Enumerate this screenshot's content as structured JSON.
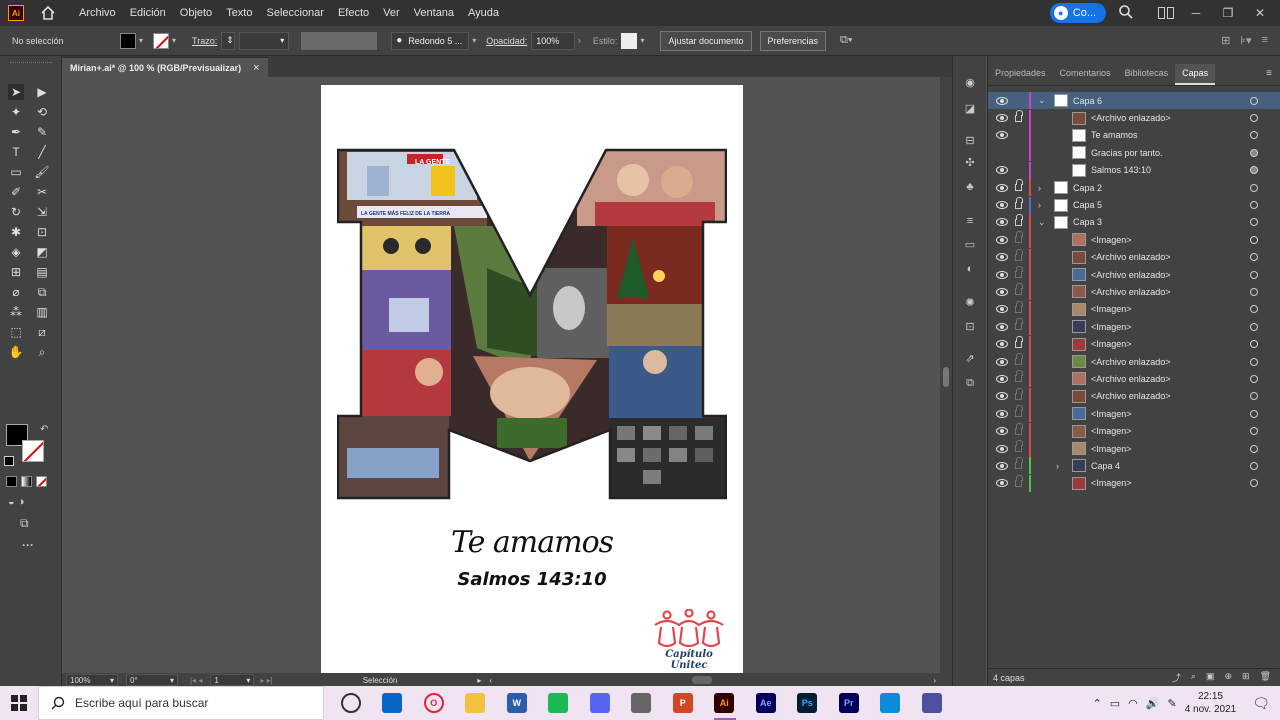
{
  "menubar": {
    "app_logo": "Ai",
    "items": [
      "Archivo",
      "Edición",
      "Objeto",
      "Texto",
      "Seleccionar",
      "Efecto",
      "Ver",
      "Ventana",
      "Ayuda"
    ],
    "cloud_label": "Co...",
    "icons": [
      "home-icon",
      "search-icon",
      "arrange-icon",
      "window-icon"
    ]
  },
  "controlbar": {
    "selection": "No selección",
    "stroke_label": "Trazo:",
    "brush": "Redondo 5 ...",
    "opacity_label": "Opacidad:",
    "opacity_value": "100%",
    "style_label": "Estilo:",
    "adjust_doc": "Ajustar documento",
    "preferences": "Preferencias"
  },
  "document": {
    "tab_title": "Mirian+.ai* @ 100 % (RGB/Previsualizar)",
    "close": "×"
  },
  "artboard": {
    "headline": "Te amamos",
    "verse": "Salmos 143:10",
    "logo_text": "Capítulo Unitec",
    "tv_caption": "LA GENTE MÁS FELIZ DE LA TIERRA",
    "tv_banner": "LA GENTE"
  },
  "statusbar": {
    "zoom": "100%",
    "rotation": "0°",
    "artboard_num": "1",
    "tool": "Selección"
  },
  "layers_panel": {
    "tabs": [
      "Propiedades",
      "Comentarios",
      "Bibliotecas",
      "Capas"
    ],
    "active_tab": "Capas",
    "rows": [
      {
        "name": "Capa 6",
        "color": "#cc44cc",
        "expanded": true,
        "indent": 0,
        "lock": false,
        "selected": true,
        "target_filled": false
      },
      {
        "name": "<Archivo enlazado>",
        "color": "#cc44cc",
        "indent": 1,
        "lock": true,
        "lock_faint": false,
        "target_filled": false
      },
      {
        "name": "Te amamos",
        "color": "#cc44cc",
        "indent": 1,
        "lock": false,
        "target_filled": false
      },
      {
        "name": "Gracias por tanto.",
        "color": "#cc44cc",
        "indent": 1,
        "lock": false,
        "no_eye": true,
        "target_filled": true
      },
      {
        "name": "Salmos 143:10",
        "color": "#cc44cc",
        "indent": 1,
        "lock": false,
        "target_filled": true
      },
      {
        "name": "Capa 2",
        "color": "#e04848",
        "collapsed": true,
        "indent": 0,
        "lock": true,
        "target_filled": false
      },
      {
        "name": "Capa 5",
        "color": "#4d6fd8",
        "collapsed": true,
        "indent": 0,
        "lock": true,
        "target_filled": false
      },
      {
        "name": "Capa 3",
        "color": "#e04848",
        "expanded": true,
        "indent": 0,
        "lock": true,
        "target_filled": false
      },
      {
        "name": "<Imagen>",
        "color": "#e04848",
        "indent": 1,
        "lock": true,
        "lock_faint": true,
        "target_filled": false
      },
      {
        "name": "<Archivo enlazado>",
        "color": "#e04848",
        "indent": 1,
        "lock": true,
        "lock_faint": true,
        "target_filled": false
      },
      {
        "name": "<Archivo enlazado>",
        "color": "#e04848",
        "indent": 1,
        "lock": true,
        "lock_faint": true,
        "target_filled": false
      },
      {
        "name": "<Archivo enlazado>",
        "color": "#e04848",
        "indent": 1,
        "lock": true,
        "lock_faint": true,
        "target_filled": false
      },
      {
        "name": "<Imagen>",
        "color": "#e04848",
        "indent": 1,
        "lock": true,
        "lock_faint": true,
        "target_filled": false
      },
      {
        "name": "<Imagen>",
        "color": "#e04848",
        "indent": 1,
        "lock": true,
        "lock_faint": true,
        "target_filled": false
      },
      {
        "name": "<Imagen>",
        "color": "#e04848",
        "indent": 1,
        "lock": true,
        "lock_faint": false,
        "target_filled": false
      },
      {
        "name": "<Archivo enlazado>",
        "color": "#e04848",
        "indent": 1,
        "lock": true,
        "lock_faint": true,
        "target_filled": false
      },
      {
        "name": "<Archivo enlazado>",
        "color": "#e04848",
        "indent": 1,
        "lock": true,
        "lock_faint": true,
        "target_filled": false
      },
      {
        "name": "<Archivo enlazado>",
        "color": "#e04848",
        "indent": 1,
        "lock": true,
        "lock_faint": true,
        "target_filled": false
      },
      {
        "name": "<Imagen>",
        "color": "#e04848",
        "indent": 1,
        "lock": true,
        "lock_faint": true,
        "target_filled": false
      },
      {
        "name": "<Imagen>",
        "color": "#e04848",
        "indent": 1,
        "lock": true,
        "lock_faint": true,
        "target_filled": false
      },
      {
        "name": "<Imagen>",
        "color": "#e04848",
        "indent": 1,
        "lock": true,
        "lock_faint": true,
        "target_filled": false
      },
      {
        "name": "Capa 4",
        "color": "#48c848",
        "collapsed": true,
        "indent": 1,
        "lock": true,
        "lock_faint": true,
        "target_filled": false
      },
      {
        "name": "<Imagen>",
        "color": "#48c848",
        "indent": 1,
        "lock": true,
        "lock_faint": true,
        "target_filled": false
      }
    ],
    "footer": "4 capas"
  },
  "taskbar": {
    "search_placeholder": "Escribe aquí para buscar",
    "apps": [
      {
        "name": "task-view-icon",
        "label": "",
        "bg": "transparent",
        "fg": "#333"
      },
      {
        "name": "mail-icon",
        "label": "",
        "bg": "#0a64c8",
        "fg": "#fff"
      },
      {
        "name": "opera-icon",
        "label": "O",
        "bg": "transparent",
        "fg": "#e0243a"
      },
      {
        "name": "explorer-icon",
        "label": "",
        "bg": "#f3c140",
        "fg": "#fff"
      },
      {
        "name": "word-icon",
        "label": "W",
        "bg": "#2b5cad",
        "fg": "#fff"
      },
      {
        "name": "spotify-icon",
        "label": "",
        "bg": "#1db954",
        "fg": "#fff"
      },
      {
        "name": "discord-icon",
        "label": "",
        "bg": "#5865f2",
        "fg": "#fff"
      },
      {
        "name": "camera-icon",
        "label": "",
        "bg": "#666",
        "fg": "#fff"
      },
      {
        "name": "powerpoint-icon",
        "label": "P",
        "bg": "#d24726",
        "fg": "#fff"
      },
      {
        "name": "illustrator-icon",
        "label": "Ai",
        "bg": "#330000",
        "fg": "#ff9a00",
        "active": true
      },
      {
        "name": "after-effects-icon",
        "label": "Ae",
        "bg": "#00005b",
        "fg": "#9999ff"
      },
      {
        "name": "photoshop-icon",
        "label": "Ps",
        "bg": "#001e36",
        "fg": "#31a8ff"
      },
      {
        "name": "premiere-icon",
        "label": "Pr",
        "bg": "#00005b",
        "fg": "#9999ff"
      },
      {
        "name": "edge-icon",
        "label": "",
        "bg": "#0c8cd8",
        "fg": "#fff"
      },
      {
        "name": "creative-cloud-icon",
        "label": "",
        "bg": "#5050a0",
        "fg": "#fff"
      }
    ],
    "time": "22:15",
    "date": "4 nov. 2021"
  }
}
